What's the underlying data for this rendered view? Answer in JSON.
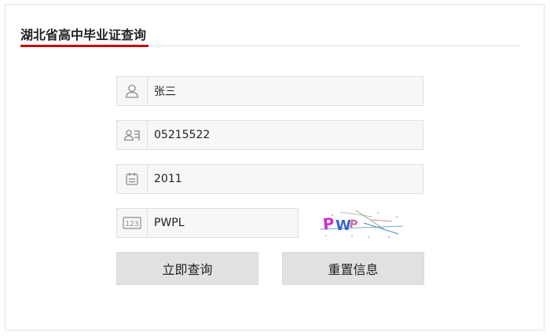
{
  "header": {
    "title": "湖北省高中毕业证查询"
  },
  "form": {
    "name": {
      "value": "张三",
      "icon": "user-icon"
    },
    "id_number": {
      "value": "05215522",
      "icon": "id-card-icon"
    },
    "year": {
      "value": "2011",
      "icon": "calendar-icon"
    },
    "captcha": {
      "value": "PWPL",
      "icon": "number-123-icon",
      "image_text": "PWP"
    }
  },
  "buttons": {
    "query": "立即查询",
    "reset": "重置信息"
  },
  "colors": {
    "accent": "#c20c0c",
    "field_bg": "#f7f7f7",
    "button_bg": "#e1e1e1",
    "captcha_p": "#cc33cc",
    "captcha_w": "#3366cc"
  }
}
